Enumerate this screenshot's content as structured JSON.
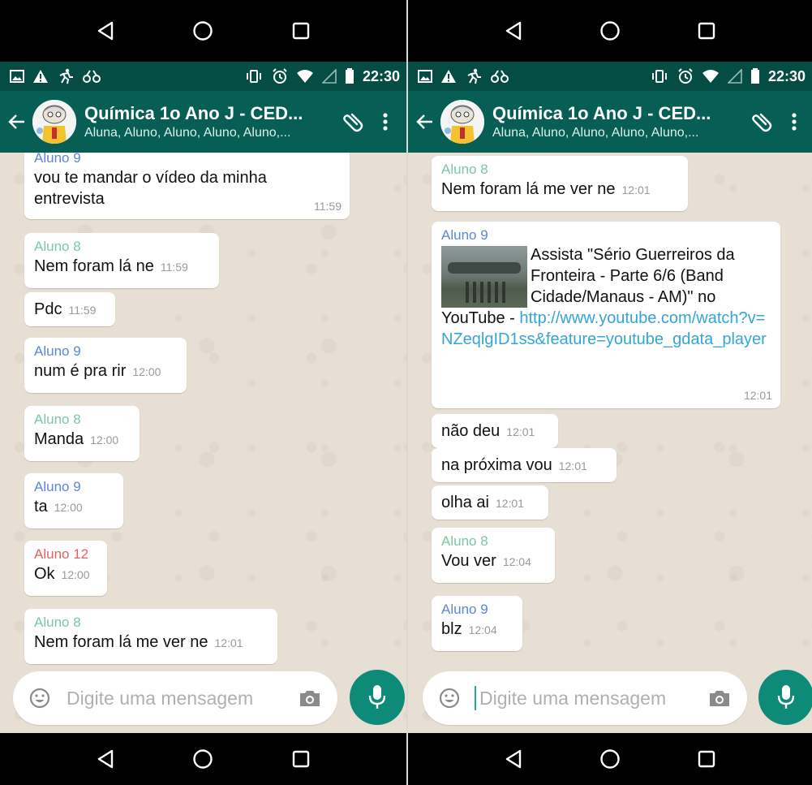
{
  "colors": {
    "header": "#075e54",
    "statusbar": "#054d44",
    "chat_bg": "#e8dfd4",
    "mic": "#0e8a78",
    "sender_aluno9": "#5c87d6",
    "sender_aluno8": "#7cc6a6",
    "sender_aluno12": "#e0625e",
    "link": "#34a5d8"
  },
  "status": {
    "time": "22:30"
  },
  "chat": {
    "title": "Química 1o Ano J - CED...",
    "subtitle": "Aluna, Aluno, Aluno, Aluno, Aluno,..."
  },
  "composer": {
    "placeholder": "Digite uma mensagem"
  },
  "left_messages": [
    {
      "sender": "Aluno 9",
      "text": "vou te mandar o  vídeo da minha entrevista",
      "time": "11:59"
    },
    {
      "sender": "Aluno 8",
      "text": "Nem foram lá ne",
      "time": "11:59"
    },
    {
      "text": "Pdc",
      "time": "11:59"
    },
    {
      "sender": "Aluno 9",
      "text": "num é pra rir",
      "time": "12:00"
    },
    {
      "sender": "Aluno 8",
      "text": "Manda",
      "time": "12:00"
    },
    {
      "sender": "Aluno 9",
      "text": "ta",
      "time": "12:00"
    },
    {
      "sender": "Aluno 12",
      "text": "Ok",
      "time": "12:00"
    },
    {
      "sender": "Aluno 8",
      "text": "Nem foram lá me ver ne",
      "time": "12:01"
    }
  ],
  "right_messages": [
    {
      "sender": "Aluno 8",
      "text": "Nem foram lá me ver ne",
      "time": "12:01"
    },
    {
      "sender": "Aluno 9",
      "text": "Assista \"Sério Guerreiros da Fronteira - Parte 6/6 (Band Cidade/Manaus - AM)\" no YouTube - ",
      "link": "http://www.youtube.com/watch?v=NZeqlgID1ss&feature=youtube_gdata_player",
      "time": "12:01"
    },
    {
      "text": "não deu",
      "time": "12:01"
    },
    {
      "text": "na próxima vou",
      "time": "12:01"
    },
    {
      "text": "olha ai",
      "time": "12:01"
    },
    {
      "sender": "Aluno 8",
      "text": "Vou ver",
      "time": "12:04"
    },
    {
      "sender": "Aluno 9",
      "text": "blz",
      "time": "12:04"
    }
  ]
}
